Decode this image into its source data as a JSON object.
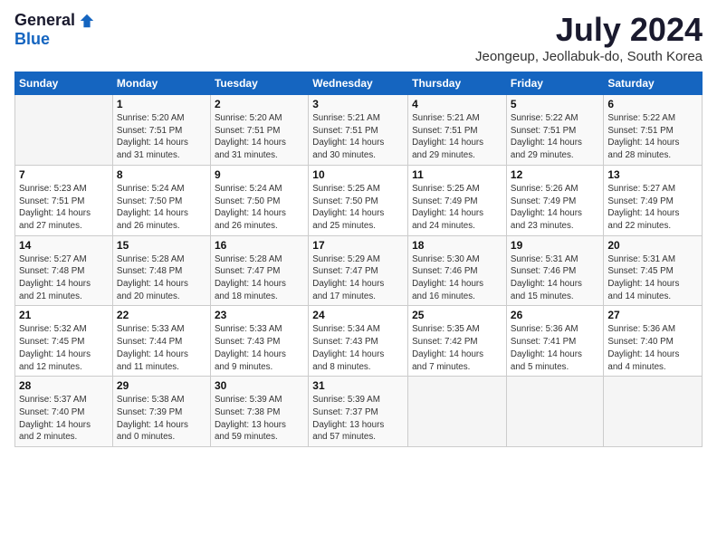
{
  "header": {
    "logo_general": "General",
    "logo_blue": "Blue",
    "title": "July 2024",
    "subtitle": "Jeongeup, Jeollabuk-do, South Korea"
  },
  "days_of_week": [
    "Sunday",
    "Monday",
    "Tuesday",
    "Wednesday",
    "Thursday",
    "Friday",
    "Saturday"
  ],
  "weeks": [
    [
      {
        "day": "",
        "info": ""
      },
      {
        "day": "1",
        "info": "Sunrise: 5:20 AM\nSunset: 7:51 PM\nDaylight: 14 hours\nand 31 minutes."
      },
      {
        "day": "2",
        "info": "Sunrise: 5:20 AM\nSunset: 7:51 PM\nDaylight: 14 hours\nand 31 minutes."
      },
      {
        "day": "3",
        "info": "Sunrise: 5:21 AM\nSunset: 7:51 PM\nDaylight: 14 hours\nand 30 minutes."
      },
      {
        "day": "4",
        "info": "Sunrise: 5:21 AM\nSunset: 7:51 PM\nDaylight: 14 hours\nand 29 minutes."
      },
      {
        "day": "5",
        "info": "Sunrise: 5:22 AM\nSunset: 7:51 PM\nDaylight: 14 hours\nand 29 minutes."
      },
      {
        "day": "6",
        "info": "Sunrise: 5:22 AM\nSunset: 7:51 PM\nDaylight: 14 hours\nand 28 minutes."
      }
    ],
    [
      {
        "day": "7",
        "info": "Sunrise: 5:23 AM\nSunset: 7:51 PM\nDaylight: 14 hours\nand 27 minutes."
      },
      {
        "day": "8",
        "info": "Sunrise: 5:24 AM\nSunset: 7:50 PM\nDaylight: 14 hours\nand 26 minutes."
      },
      {
        "day": "9",
        "info": "Sunrise: 5:24 AM\nSunset: 7:50 PM\nDaylight: 14 hours\nand 26 minutes."
      },
      {
        "day": "10",
        "info": "Sunrise: 5:25 AM\nSunset: 7:50 PM\nDaylight: 14 hours\nand 25 minutes."
      },
      {
        "day": "11",
        "info": "Sunrise: 5:25 AM\nSunset: 7:49 PM\nDaylight: 14 hours\nand 24 minutes."
      },
      {
        "day": "12",
        "info": "Sunrise: 5:26 AM\nSunset: 7:49 PM\nDaylight: 14 hours\nand 23 minutes."
      },
      {
        "day": "13",
        "info": "Sunrise: 5:27 AM\nSunset: 7:49 PM\nDaylight: 14 hours\nand 22 minutes."
      }
    ],
    [
      {
        "day": "14",
        "info": "Sunrise: 5:27 AM\nSunset: 7:48 PM\nDaylight: 14 hours\nand 21 minutes."
      },
      {
        "day": "15",
        "info": "Sunrise: 5:28 AM\nSunset: 7:48 PM\nDaylight: 14 hours\nand 20 minutes."
      },
      {
        "day": "16",
        "info": "Sunrise: 5:28 AM\nSunset: 7:47 PM\nDaylight: 14 hours\nand 18 minutes."
      },
      {
        "day": "17",
        "info": "Sunrise: 5:29 AM\nSunset: 7:47 PM\nDaylight: 14 hours\nand 17 minutes."
      },
      {
        "day": "18",
        "info": "Sunrise: 5:30 AM\nSunset: 7:46 PM\nDaylight: 14 hours\nand 16 minutes."
      },
      {
        "day": "19",
        "info": "Sunrise: 5:31 AM\nSunset: 7:46 PM\nDaylight: 14 hours\nand 15 minutes."
      },
      {
        "day": "20",
        "info": "Sunrise: 5:31 AM\nSunset: 7:45 PM\nDaylight: 14 hours\nand 14 minutes."
      }
    ],
    [
      {
        "day": "21",
        "info": "Sunrise: 5:32 AM\nSunset: 7:45 PM\nDaylight: 14 hours\nand 12 minutes."
      },
      {
        "day": "22",
        "info": "Sunrise: 5:33 AM\nSunset: 7:44 PM\nDaylight: 14 hours\nand 11 minutes."
      },
      {
        "day": "23",
        "info": "Sunrise: 5:33 AM\nSunset: 7:43 PM\nDaylight: 14 hours\nand 9 minutes."
      },
      {
        "day": "24",
        "info": "Sunrise: 5:34 AM\nSunset: 7:43 PM\nDaylight: 14 hours\nand 8 minutes."
      },
      {
        "day": "25",
        "info": "Sunrise: 5:35 AM\nSunset: 7:42 PM\nDaylight: 14 hours\nand 7 minutes."
      },
      {
        "day": "26",
        "info": "Sunrise: 5:36 AM\nSunset: 7:41 PM\nDaylight: 14 hours\nand 5 minutes."
      },
      {
        "day": "27",
        "info": "Sunrise: 5:36 AM\nSunset: 7:40 PM\nDaylight: 14 hours\nand 4 minutes."
      }
    ],
    [
      {
        "day": "28",
        "info": "Sunrise: 5:37 AM\nSunset: 7:40 PM\nDaylight: 14 hours\nand 2 minutes."
      },
      {
        "day": "29",
        "info": "Sunrise: 5:38 AM\nSunset: 7:39 PM\nDaylight: 14 hours\nand 0 minutes."
      },
      {
        "day": "30",
        "info": "Sunrise: 5:39 AM\nSunset: 7:38 PM\nDaylight: 13 hours\nand 59 minutes."
      },
      {
        "day": "31",
        "info": "Sunrise: 5:39 AM\nSunset: 7:37 PM\nDaylight: 13 hours\nand 57 minutes."
      },
      {
        "day": "",
        "info": ""
      },
      {
        "day": "",
        "info": ""
      },
      {
        "day": "",
        "info": ""
      }
    ]
  ]
}
